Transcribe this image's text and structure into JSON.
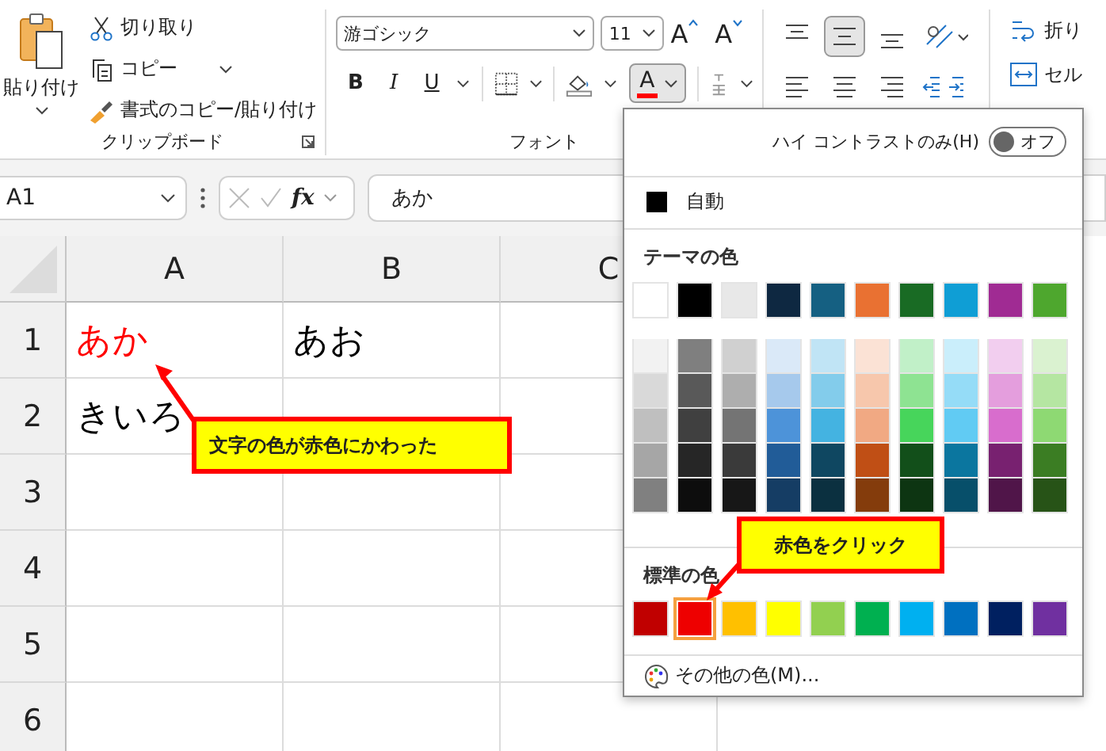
{
  "ribbon": {
    "clipboard": {
      "paste_label": "貼り付け",
      "items": [
        {
          "kind": "cut",
          "label": "切り取り",
          "dropdown": false
        },
        {
          "kind": "copy",
          "label": "コピー",
          "dropdown": true
        },
        {
          "kind": "painter",
          "label": "書式のコピー/貼り付け",
          "dropdown": false
        }
      ],
      "group_label": "クリップボード"
    },
    "font": {
      "font_name": "游ゴシック",
      "font_size": "11",
      "grow_glyph": "A",
      "shrink_glyph": "A",
      "format_buttons": [
        {
          "kind": "bold",
          "glyph": "B"
        },
        {
          "kind": "italic",
          "glyph": "I"
        },
        {
          "kind": "underline",
          "glyph": "U"
        }
      ],
      "font_color": {
        "glyph": "A",
        "color": "#ff0000",
        "open": true
      },
      "group_label": "フォント"
    },
    "wrap": {
      "wrap_text": "折り",
      "merge": "セル"
    }
  },
  "formula_bar": {
    "name_box": "A1",
    "fx": "fx",
    "value": "あか"
  },
  "sheet": {
    "columns": [
      {
        "label": "A"
      },
      {
        "label": "B"
      },
      {
        "label": "C"
      }
    ],
    "rows": [
      {
        "label": "1",
        "cells": [
          {
            "text": "あか",
            "color": "#ff0000"
          },
          {
            "text": "あお",
            "color": "#000000"
          }
        ]
      },
      {
        "label": "2",
        "cells": [
          {
            "text": "きいろ",
            "color": "#000000"
          }
        ]
      },
      {
        "label": "3"
      },
      {
        "label": "4"
      },
      {
        "label": "5"
      },
      {
        "label": "6"
      }
    ]
  },
  "color_menu": {
    "high_contrast": {
      "label": "ハイ コントラストのみ(H)",
      "on": false,
      "state_text": "オフ"
    },
    "automatic": {
      "label": "自動",
      "color": "#000000"
    },
    "theme_heading": "テーマの色",
    "theme_columns": [
      {
        "color": "#ffffff",
        "shades": [
          {
            "color": "#f2f2f2"
          },
          {
            "color": "#d9d9d9"
          },
          {
            "color": "#bfbfbf"
          },
          {
            "color": "#a6a6a6"
          },
          {
            "color": "#808080"
          }
        ]
      },
      {
        "color": "#000000",
        "shades": [
          {
            "color": "#7f7f7f"
          },
          {
            "color": "#595959"
          },
          {
            "color": "#404040"
          },
          {
            "color": "#262626"
          },
          {
            "color": "#0d0d0d"
          }
        ]
      },
      {
        "color": "#e8e8e8",
        "shades": [
          {
            "color": "#d0d0d0"
          },
          {
            "color": "#aeaeae"
          },
          {
            "color": "#747474"
          },
          {
            "color": "#3a3a3a"
          },
          {
            "color": "#171717"
          }
        ]
      },
      {
        "color": "#0e2841",
        "shades": [
          {
            "color": "#dae9f8"
          },
          {
            "color": "#a6c9ec"
          },
          {
            "color": "#4d93d9"
          },
          {
            "color": "#215c98"
          },
          {
            "color": "#153d64"
          }
        ]
      },
      {
        "color": "#156082",
        "shades": [
          {
            "color": "#c0e4f5"
          },
          {
            "color": "#83cceb"
          },
          {
            "color": "#44b3e1"
          },
          {
            "color": "#0f4761"
          },
          {
            "color": "#0b3040"
          }
        ]
      },
      {
        "color": "#e97132",
        "shades": [
          {
            "color": "#fbe2d5"
          },
          {
            "color": "#f7c7ac"
          },
          {
            "color": "#f1a983"
          },
          {
            "color": "#c04f15"
          },
          {
            "color": "#843c0c"
          }
        ]
      },
      {
        "color": "#196b24",
        "shades": [
          {
            "color": "#c1f0c8"
          },
          {
            "color": "#8ee392"
          },
          {
            "color": "#47d55b"
          },
          {
            "color": "#124f1a"
          },
          {
            "color": "#0d3512"
          }
        ]
      },
      {
        "color": "#0f9ed5",
        "shades": [
          {
            "color": "#caeefb"
          },
          {
            "color": "#95dcf7"
          },
          {
            "color": "#61cbf3"
          },
          {
            "color": "#0b769f"
          },
          {
            "color": "#074f6a"
          }
        ]
      },
      {
        "color": "#a02b93",
        "shades": [
          {
            "color": "#f2ceef"
          },
          {
            "color": "#e49edd"
          },
          {
            "color": "#d86dcd"
          },
          {
            "color": "#782170"
          },
          {
            "color": "#501549"
          }
        ]
      },
      {
        "color": "#4ea72e",
        "shades": [
          {
            "color": "#daf2d0"
          },
          {
            "color": "#b5e6a2"
          },
          {
            "color": "#8ed973"
          },
          {
            "color": "#3b7d23"
          },
          {
            "color": "#275317"
          }
        ]
      }
    ],
    "standard_heading": "標準の色",
    "standard_colors": [
      {
        "color": "#c00000",
        "selected": false
      },
      {
        "color": "#ee0000",
        "selected": true
      },
      {
        "color": "#ffc000",
        "selected": false
      },
      {
        "color": "#ffff00",
        "selected": false
      },
      {
        "color": "#92d050",
        "selected": false
      },
      {
        "color": "#00b050",
        "selected": false
      },
      {
        "color": "#00b0f0",
        "selected": false
      },
      {
        "color": "#0070c0",
        "selected": false
      },
      {
        "color": "#002060",
        "selected": false
      },
      {
        "color": "#7030a0",
        "selected": false
      }
    ],
    "more_colors": "その他の色(M)..."
  },
  "callouts": [
    {
      "text": "文字の色が赤色にかわった"
    },
    {
      "text": "赤色をクリック"
    }
  ]
}
